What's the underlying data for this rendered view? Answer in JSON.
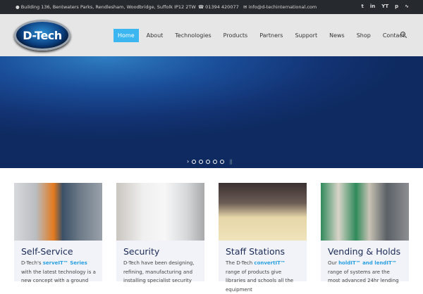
{
  "topbar": {
    "address": "Building 136, Bentwaters Parks, Rendlesham, Woodbridge, Suffolk IP12 2TW",
    "phone": "01394 420077",
    "email": "info@d-techinternational.com",
    "social": [
      "twitter-icon",
      "linkedin-icon",
      "youtube-icon",
      "pinterest-icon",
      "rss-icon"
    ],
    "yt": "YT"
  },
  "logo": "D-Tech",
  "nav": [
    "Home",
    "About",
    "Technologies",
    "Products",
    "Partners",
    "Support",
    "News",
    "Shop",
    "Contact"
  ],
  "colors": {
    "accent": "#3bb6f0",
    "title": "#1b2a55"
  },
  "slider": {
    "slides": 5
  },
  "cards": [
    {
      "title": "Self-Service",
      "pre": "D-Tech's ",
      "link": "serveIT™ Series",
      "post": " with the latest technology is a new concept with a ground"
    },
    {
      "title": "Security",
      "pre": "D-Tech have been designing, refining, manufacturing and installing specialist security",
      "link": "",
      "post": ""
    },
    {
      "title": "Staff Stations",
      "pre": "The D-Tech ",
      "link": "convertIT™",
      "post": " range of products give libraries and schools all the equipment"
    },
    {
      "title": "Vending & Holds",
      "pre": "Our ",
      "link": "holdIT™ and lendIT™",
      "post": " range of systems are the most advanced 24hr lending"
    }
  ]
}
